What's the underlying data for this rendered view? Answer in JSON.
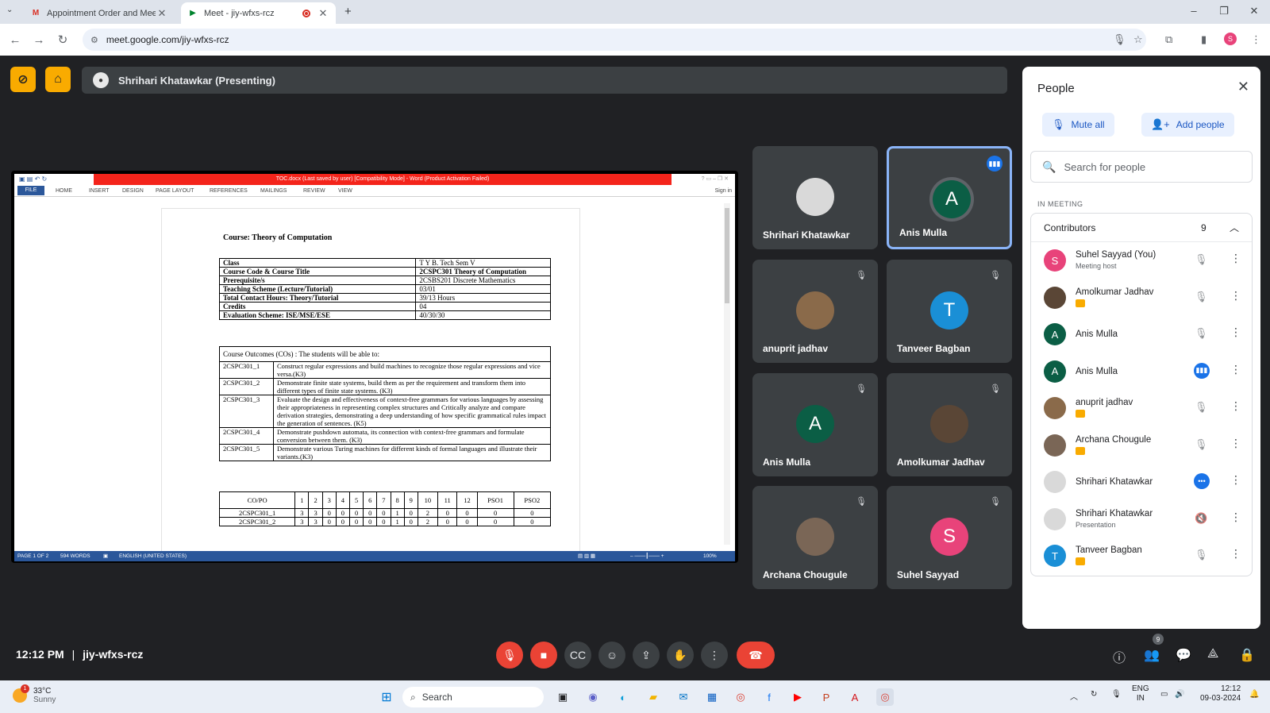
{
  "browser": {
    "tabs": [
      {
        "title": "Appointment Order and Meeti",
        "favicon": "gmail-icon",
        "active": false
      },
      {
        "title": "Meet - jiy-wfxs-rcz",
        "favicon": "meet-icon",
        "active": true
      }
    ],
    "url": "meet.google.com/jiy-wfxs-rcz",
    "profile_initial": "S"
  },
  "meet": {
    "presenter_label": "Shrihari Khatawkar (Presenting)",
    "time": "12:12 PM",
    "separator": "|",
    "meeting_code": "jiy-wfxs-rcz",
    "participants_badge": "9"
  },
  "word": {
    "title": "TOC.docx (Last saved by user) [Compatibility Mode] - Word (Product Activation Failed)",
    "ribbon_tabs": [
      "FILE",
      "HOME",
      "INSERT",
      "DESIGN",
      "PAGE LAYOUT",
      "REFERENCES",
      "MAILINGS",
      "REVIEW",
      "VIEW"
    ],
    "sign_in": "Sign in",
    "status": {
      "page": "PAGE 1 OF 2",
      "words": "594 WORDS",
      "language": "ENGLISH (UNITED STATES)",
      "zoom": "100%"
    },
    "doc_heading": "Course: Theory of Computation",
    "course_table": [
      [
        "Class",
        "T Y B. Tech Sem V"
      ],
      [
        "Course Code & Course Title",
        "2CSPC301 Theory of Computation"
      ],
      [
        "Prerequisite/s",
        "2CSBS201 Discrete Mathematics"
      ],
      [
        "Teaching Scheme (Lecture/Tutorial)",
        "03/01"
      ],
      [
        "Total Contact Hours: Theory/Tutorial",
        "39/13 Hours"
      ],
      [
        "Credits",
        "04"
      ],
      [
        "Evaluation Scheme: ISE/MSE/ESE",
        "40/30/30"
      ]
    ],
    "co_header": "Course Outcomes (COs) : The students will be able to:",
    "co_rows": [
      [
        "2CSPC301_1",
        "Construct regular expressions and build machines to recognize those regular expressions and vice versa.(K3)"
      ],
      [
        "2CSPC301_2",
        "Demonstrate finite state systems, build them as per the requirement and transform them into different types of finite state systems. (K3)"
      ],
      [
        "2CSPC301_3",
        "Evaluate the design and effectiveness of context-free grammars for various languages by assessing their appropriateness in representing complex structures and Critically analyze and compare derivation strategies, demonstrating a deep understanding of how specific grammatical rules impact the generation of sentences. (K5)"
      ],
      [
        "2CSPC301_4",
        "Demonstrate pushdown automata, its connection with context-free grammars and formulate conversion between them. (K3)"
      ],
      [
        "2CSPC301_5",
        "Demonstrate various Turing machines for different kinds of formal languages and illustrate their variants.(K3)"
      ]
    ],
    "copo_header": [
      "CO/PO",
      "1",
      "2",
      "3",
      "4",
      "5",
      "6",
      "7",
      "8",
      "9",
      "10",
      "11",
      "12",
      "PSO1",
      "PSO2"
    ],
    "copo_rows": [
      [
        "2CSPC301_1",
        "3",
        "3",
        "0",
        "0",
        "0",
        "0",
        "0",
        "1",
        "0",
        "2",
        "0",
        "0",
        "0",
        "0"
      ],
      [
        "2CSPC301_2",
        "3",
        "3",
        "0",
        "0",
        "0",
        "0",
        "0",
        "1",
        "0",
        "2",
        "0",
        "0",
        "0",
        "0"
      ]
    ]
  },
  "tiles": [
    {
      "name": "Shrihari Khatawkar",
      "initial": "",
      "color": "#d9d9d9",
      "muted": false,
      "speaking": false
    },
    {
      "name": "Anis Mulla",
      "initial": "A",
      "color": "#0b5e45",
      "muted": false,
      "speaking": true
    },
    {
      "name": "anuprit jadhav",
      "initial": "",
      "color": "#8a6a4a",
      "muted": true,
      "speaking": false
    },
    {
      "name": "Tanveer Bagban",
      "initial": "T",
      "color": "#1a8fd6",
      "muted": true,
      "speaking": false
    },
    {
      "name": "Anis Mulla",
      "initial": "A",
      "color": "#0b5e45",
      "muted": true,
      "speaking": false
    },
    {
      "name": "Amolkumar Jadhav",
      "initial": "",
      "color": "#5a4636",
      "muted": true,
      "speaking": false
    },
    {
      "name": "Archana Chougule",
      "initial": "",
      "color": "#7a6656",
      "muted": true,
      "speaking": false
    },
    {
      "name": "Suhel Sayyad",
      "initial": "S",
      "color": "#e8437a",
      "muted": true,
      "speaking": false
    }
  ],
  "people": {
    "title": "People",
    "mute_all": "Mute all",
    "add_people": "Add people",
    "search_placeholder": "Search for people",
    "section": "IN MEETING",
    "group_label": "Contributors",
    "group_count": "9",
    "list": [
      {
        "name": "Suhel Sayyad (You)",
        "sub": "Meeting host",
        "initial": "S",
        "color": "#e8437a",
        "status": "muted",
        "chip": false
      },
      {
        "name": "Amolkumar Jadhav",
        "sub": "",
        "initial": "",
        "color": "#5a4636",
        "status": "muted",
        "chip": true
      },
      {
        "name": "Anis Mulla",
        "sub": "",
        "initial": "A",
        "color": "#0b5e45",
        "status": "muted",
        "chip": false
      },
      {
        "name": "Anis Mulla",
        "sub": "",
        "initial": "A",
        "color": "#0b5e45",
        "status": "speaking",
        "chip": false
      },
      {
        "name": "anuprit jadhav",
        "sub": "",
        "initial": "",
        "color": "#8a6a4a",
        "status": "muted",
        "chip": true
      },
      {
        "name": "Archana Chougule",
        "sub": "",
        "initial": "",
        "color": "#7a6656",
        "status": "muted",
        "chip": true
      },
      {
        "name": "Shrihari Khatawkar",
        "sub": "",
        "initial": "",
        "color": "#d9d9d9",
        "status": "active",
        "chip": false
      },
      {
        "name": "Shrihari Khatawkar",
        "sub": "Presentation",
        "initial": "",
        "color": "#d9d9d9",
        "status": "audio-off",
        "chip": false
      },
      {
        "name": "Tanveer Bagban",
        "sub": "",
        "initial": "T",
        "color": "#1a8fd6",
        "status": "muted",
        "chip": true
      }
    ]
  },
  "taskbar": {
    "temp": "33°C",
    "weather": "Sunny",
    "weather_badge": "1",
    "search": "Search",
    "lang_top": "ENG",
    "lang_bottom": "IN",
    "time": "12:12",
    "date": "09-03-2024"
  }
}
